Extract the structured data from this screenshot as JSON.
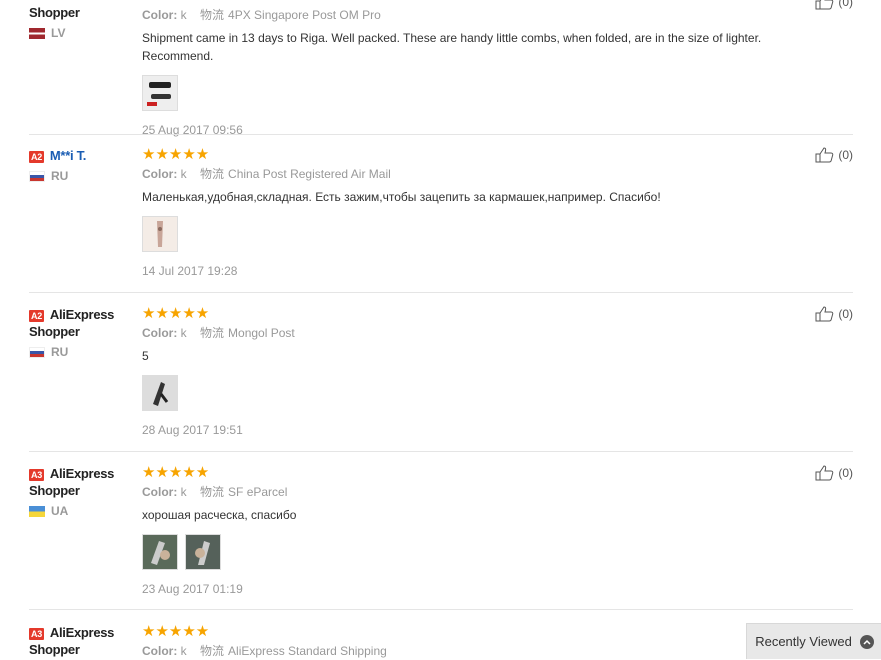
{
  "reviews": [
    {
      "badge": "",
      "name": "Shopper",
      "country": "LV",
      "color_label": "Color:",
      "color_value": "k",
      "shipping_label": "物流",
      "shipping_value": "4PX Singapore Post OM Pro",
      "text": "Shipment came in 13 days to Riga. Well packed. These are handy little combs, when folded, are in the size of lighter. Recommend.",
      "date": "25 Aug 2017 09:56",
      "likes": "(0)"
    },
    {
      "badge": "A2",
      "name": "M**i T.",
      "country": "RU",
      "stars": "★★★★★",
      "color_label": "Color:",
      "color_value": "k",
      "shipping_label": "物流",
      "shipping_value": "China Post Registered Air Mail",
      "text": "Маленькая,удобная,складная. Есть зажим,чтобы зацепить за кармашек,например. Спасибо!",
      "date": "14 Jul 2017 19:28",
      "likes": "(0)"
    },
    {
      "badge": "A2",
      "name": "AliExpress Shopper",
      "country": "RU",
      "stars": "★★★★★",
      "color_label": "Color:",
      "color_value": "k",
      "shipping_label": "物流",
      "shipping_value": "Mongol Post",
      "text": "5",
      "date": "28 Aug 2017 19:51",
      "likes": "(0)"
    },
    {
      "badge": "A3",
      "name": "AliExpress Shopper",
      "country": "UA",
      "stars": "★★★★★",
      "color_label": "Color:",
      "color_value": "k",
      "shipping_label": "物流",
      "shipping_value": "SF eParcel",
      "text": "хорошая расческа, спасибо",
      "date": "23 Aug 2017 01:19",
      "likes": "(0)"
    },
    {
      "badge": "A3",
      "name": "AliExpress Shopper",
      "country": "",
      "stars": "★★★★★",
      "color_label": "Color:",
      "color_value": "k",
      "shipping_label": "物流",
      "shipping_value": "AliExpress Standard Shipping"
    }
  ],
  "recently_viewed": "Recently Viewed",
  "colors": {
    "badge": "#e4392b",
    "stars": "#f7a400",
    "link": "#1a5db3"
  }
}
